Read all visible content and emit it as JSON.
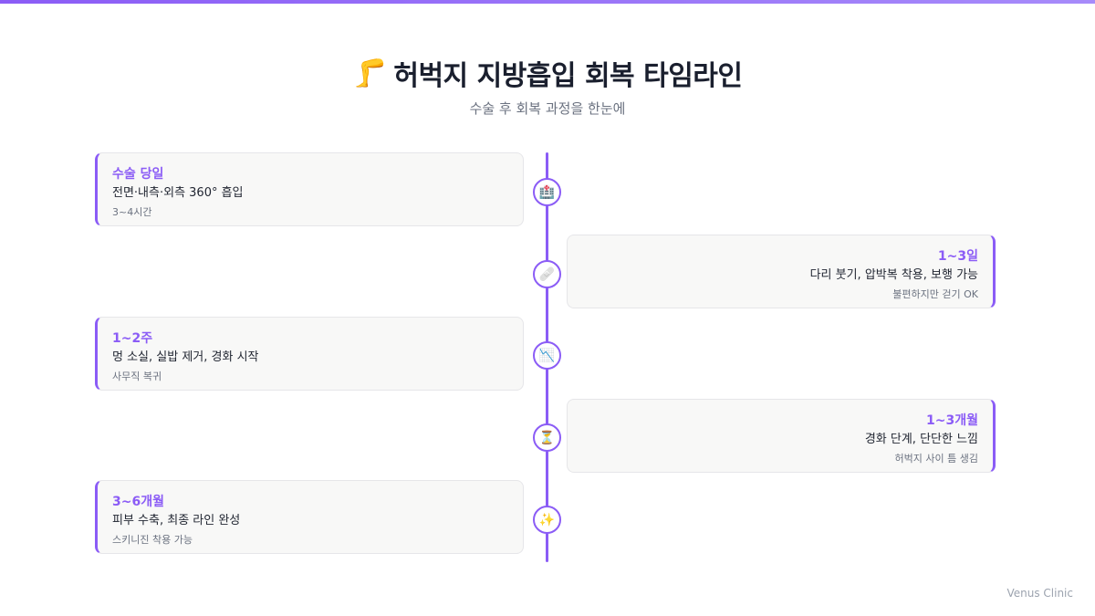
{
  "header": {
    "icon": "🦵",
    "title": "허벅지 지방흡입 회복 타임라인",
    "subtitle": "수술 후 회복 과정을 한눈에"
  },
  "timeline": [
    {
      "side": "left",
      "icon": "🏥",
      "icon_name": "hospital-icon",
      "title": "수술 당일",
      "desc": "전면·내측·외측 360° 흡입",
      "note": "3~4시간"
    },
    {
      "side": "right",
      "icon": "🩹",
      "icon_name": "bandage-icon",
      "title": "1~3일",
      "desc": "다리 붓기, 압박복 착용, 보행 가능",
      "note": "불편하지만 걷기 OK"
    },
    {
      "side": "left",
      "icon": "📉",
      "icon_name": "chart-down-icon",
      "title": "1~2주",
      "desc": "멍 소실, 실밥 제거, 경화 시작",
      "note": "사무직 복귀"
    },
    {
      "side": "right",
      "icon": "⏳",
      "icon_name": "hourglass-icon",
      "title": "1~3개월",
      "desc": "경화 단계, 단단한 느낌",
      "note": "허벅지 사이 틈 생김"
    },
    {
      "side": "left",
      "icon": "✨",
      "icon_name": "sparkles-icon",
      "title": "3~6개월",
      "desc": "피부 수축, 최종 라인 완성",
      "note": "스키니진 착용 가능"
    }
  ],
  "footer": {
    "brand": "Venus Clinic"
  },
  "colors": {
    "accent": "#8b5cf6",
    "card_bg": "#f8f8f7",
    "text": "#1f2430",
    "muted": "#6b7280"
  }
}
